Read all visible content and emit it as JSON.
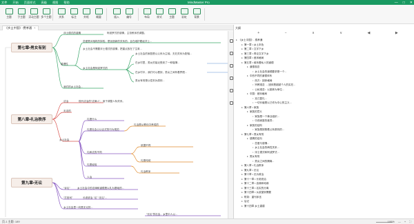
{
  "window": {
    "title": "MindMaster Pro"
  },
  "menu": [
    "文件",
    "开始",
    "页面样式",
    "高级",
    "视图",
    "帮助"
  ],
  "window_buttons": [
    "—",
    "□",
    "✕"
  ],
  "toolbar": {
    "items": [
      {
        "label": "主题",
        "icon": "topic-icon"
      },
      {
        "label": "子主题",
        "icon": "subtopic-icon"
      },
      {
        "label": "浮动主题",
        "icon": "float-topic-icon"
      },
      {
        "label": "多个主题",
        "icon": "multi-topic-icon"
      },
      {
        "label": "关系",
        "icon": "relation-icon"
      },
      {
        "label": "标注",
        "icon": "callout-icon"
      },
      {
        "label": "外框",
        "icon": "boundary-icon"
      },
      {
        "label": "概要",
        "icon": "summary-icon"
      },
      {
        "label": "插入",
        "icon": "insert-icon"
      },
      {
        "label": "编号",
        "icon": "numbering-icon"
      },
      {
        "label": "布局",
        "icon": "layout-icon"
      },
      {
        "label": "样式",
        "icon": "style-icon"
      },
      {
        "label": "主题",
        "icon": "theme-icon"
      },
      {
        "label": "彩虹",
        "icon": "rainbow-icon"
      },
      {
        "label": "背景",
        "icon": "background-icon"
      }
    ]
  },
  "tab": {
    "label": "《乡土中国》-费孝通",
    "close": "×"
  },
  "mindmap": {
    "chapters": [
      {
        "name": "第七章•男女有别"
      },
      {
        "name": "第八章•礼治秩序"
      },
      {
        "name": "第九章•无讼"
      }
    ],
    "nodes": [
      "浮士德式的感情",
      "阿波罗式的感情，主张秩序的调整。",
      "恋爱是对相机的探险，是创造新的关系的，且在维护着经济上...",
      "乡土社会不需要浮士德式的感情，把重点放在了生育...",
      "重理性",
      "乡土社会是阿波罗式的",
      "乡土社会的家庭是以父系为主轴，夫妇关系为配轴...",
      "在乡村里，男女的接近受到了一种阻隔...",
      "在乡村中，我们可以看到，男女之间有着界限...",
      "男女有别是以性别为原则...",
      "我们的乡土社会...",
      "法治",
      "现代法治的“法律人”，用于调整人际关系。",
      "无法的",
      "礼",
      "乡土社会",
      "人治",
      "礼是什么",
      "礼是社会公认合式的行为规范",
      "礼治是从教化中养成的",
      "礼和法的不同",
      "依据不同",
      "礼是传统",
      "礼是经验",
      "礼治秩序",
      "“诉讼”",
      "乡土社会中的法律和道德是以礼为基础的...",
      "“打官司”",
      "长老统治 “讼” “无讼”...",
      "乡土社会里一向是无讼的...",
      "“无讼”的社会，乡里中人以..."
    ],
    "labels": [
      "男女有别",
      "礼治秩序",
      "无讼"
    ]
  },
  "outline": {
    "title": "大纲",
    "tools": [
      "+",
      "−",
      "∧",
      "∨",
      "◀",
      "▶"
    ],
    "rows": [
      {
        "level": 0,
        "text": "《乡土中国》- 费孝通"
      },
      {
        "level": 1,
        "text": "第一章 • 乡土本色"
      },
      {
        "level": 1,
        "text": "第二章 • 文字下乡"
      },
      {
        "level": 1,
        "text": "第三章 • 再论文字下乡"
      },
      {
        "level": 1,
        "text": "第四章 • 差序格局"
      },
      {
        "level": 1,
        "text": "第五章 • 维系着私人的道德"
      },
      {
        "level": 2,
        "text": "道德观念"
      },
      {
        "level": 3,
        "text": "乡土社会的道德要求是一个..."
      },
      {
        "level": 2,
        "text": "中西不同的道德体系"
      },
      {
        "level": 3,
        "text": "西方：团体格局"
      },
      {
        "level": 3,
        "text": "宗教观念 → 团体是超越个人的实在..."
      },
      {
        "level": 3,
        "text": "公私观念：以团体为单位..."
      },
      {
        "level": 2,
        "text": "中国：差序格局"
      },
      {
        "level": 3,
        "text": "克己复礼..."
      },
      {
        "level": 3,
        "text": "一切价值是以己作为中心的主义..."
      },
      {
        "level": 1,
        "text": "第六章 • 家族"
      },
      {
        "level": 2,
        "text": "家族的意义"
      },
      {
        "level": 3,
        "text": "家族是一个事业组织..."
      },
      {
        "level": 3,
        "text": "中西家庭的差异..."
      },
      {
        "level": 2,
        "text": "家族的结构"
      },
      {
        "level": 3,
        "text": "家族是按照着父系原则的..."
      },
      {
        "level": 1,
        "text": "第七章 • 男女有别"
      },
      {
        "level": 2,
        "text": "感情的定向"
      },
      {
        "level": 3,
        "text": "恋爱与感情..."
      },
      {
        "level": 3,
        "text": "乡土社会的两性关系..."
      },
      {
        "level": 3,
        "text": "浮士德式和阿波罗式..."
      },
      {
        "level": 2,
        "text": "男女有别"
      },
      {
        "level": 3,
        "text": "男女之间的隔离..."
      },
      {
        "level": 1,
        "text": "第八章 • 礼治秩序"
      },
      {
        "level": 1,
        "text": "第九章 • 无讼"
      },
      {
        "level": 1,
        "text": "第十章 • 无为政治"
      },
      {
        "level": 1,
        "text": "第十一章 • 长老统治"
      },
      {
        "level": 1,
        "text": "第十二章 • 血缘和地缘"
      },
      {
        "level": 1,
        "text": "第十三章 • 名实的分离"
      },
      {
        "level": 1,
        "text": "第十四章 • 从欲望到需要"
      },
      {
        "level": 1,
        "text": "附录：重刊序言"
      },
      {
        "level": 1,
        "text": "后记"
      },
      {
        "level": 1,
        "text": "第十四章 乡土重建"
      }
    ]
  },
  "statusbar": {
    "left": "页-1 主题: 189",
    "right": [
      "100%",
      "—",
      "+",
      "⛶"
    ]
  },
  "colors": {
    "titlebar": "#1a9a62",
    "chapter_fill": "#f6eee9",
    "line_green": "#3aa66a",
    "line_red": "#d9534f",
    "line_blue": "#5b8fd1",
    "line_purple": "#8a5bc2",
    "line_orange": "#e08b2d"
  }
}
